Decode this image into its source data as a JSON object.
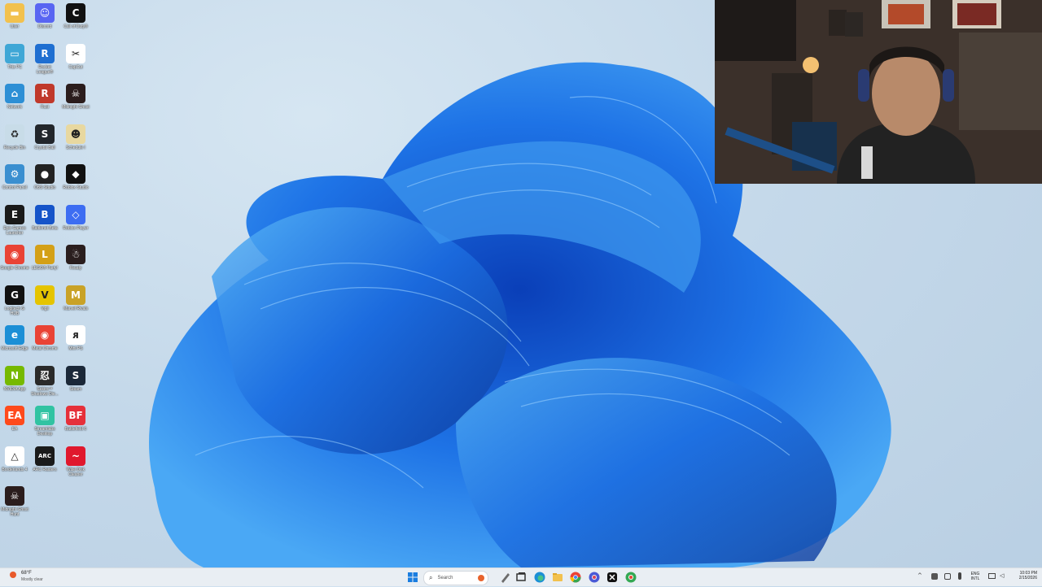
{
  "desktop": {
    "icons": [
      {
        "label": "User",
        "color": "#f2c14e",
        "glyph": "▬",
        "icon": "folder-icon"
      },
      {
        "label": "Discord",
        "color": "#5865f2",
        "glyph": "☺",
        "icon": "discord-icon"
      },
      {
        "label": "Call of Duty®",
        "color": "#111111",
        "glyph": "C",
        "icon": "call-of-duty-icon"
      },
      {
        "label": "This PC",
        "color": "#3fa7d6",
        "glyph": "▭",
        "icon": "this-pc-icon"
      },
      {
        "label": "Rocket League®",
        "color": "#1f6fd1",
        "glyph": "R",
        "icon": "rocket-league-icon"
      },
      {
        "label": "CapCut",
        "color": "#ffffff",
        "glyph": "✂",
        "icon": "capcut-icon"
      },
      {
        "label": "Network",
        "color": "#2d8fd5",
        "glyph": "⌂",
        "icon": "network-icon"
      },
      {
        "label": "Rust",
        "color": "#c0392b",
        "glyph": "R",
        "icon": "rust-icon"
      },
      {
        "label": "Midnight Ghost",
        "color": "#2b1d1d",
        "glyph": "☠",
        "icon": "midnight-ghost-icon"
      },
      {
        "label": "Recycle Bin",
        "color": "#c8dce8",
        "glyph": "♻",
        "icon": "recycle-bin-icon"
      },
      {
        "label": "Crystal Ball",
        "color": "#22262b",
        "glyph": "S",
        "icon": "crystal-ball-icon"
      },
      {
        "label": "Schedule I",
        "color": "#e8d8a0",
        "glyph": "☻",
        "icon": "schedule-icon"
      },
      {
        "label": "Control Panel",
        "color": "#3a8fd0",
        "glyph": "⚙",
        "icon": "control-panel-icon"
      },
      {
        "label": "OBS Studio",
        "color": "#222222",
        "glyph": "●",
        "icon": "obs-studio-icon"
      },
      {
        "label": "Roblox Studio",
        "color": "#111111",
        "glyph": "◆",
        "icon": "roblox-studio-icon"
      },
      {
        "label": "Epic Games Launcher",
        "color": "#1a1a1a",
        "glyph": "E",
        "icon": "epic-games-icon"
      },
      {
        "label": "Battlenet Beta",
        "color": "#1554c9",
        "glyph": "B",
        "icon": "battlenet-icon"
      },
      {
        "label": "Roblox Player",
        "color": "#3d6df2",
        "glyph": "◇",
        "icon": "roblox-player-icon"
      },
      {
        "label": "Google Chrome",
        "color": "#e94335",
        "glyph": "◉",
        "icon": "chrome-icon"
      },
      {
        "label": "LEGO® Party!",
        "color": "#d4a017",
        "glyph": "L",
        "icon": "lego-party-icon"
      },
      {
        "label": "Ready",
        "color": "#2a1e1e",
        "glyph": "☃",
        "icon": "ready-icon"
      },
      {
        "label": "Logitech G HUB",
        "color": "#111111",
        "glyph": "G",
        "icon": "logitech-ghub-icon"
      },
      {
        "label": "Vigil",
        "color": "#e5c400",
        "glyph": "V",
        "icon": "vigil-icon"
      },
      {
        "label": "Marvel Rivals",
        "color": "#c9a227",
        "glyph": "M",
        "icon": "marvel-rivals-icon"
      },
      {
        "label": "Microsoft Edge",
        "color": "#1b8fd6",
        "glyph": "e",
        "icon": "edge-icon"
      },
      {
        "label": "Metal Chrome",
        "color": "#e94335",
        "glyph": "◉",
        "icon": "metal-chrome-icon"
      },
      {
        "label": "Mini PS",
        "color": "#ffffff",
        "glyph": "ᴙ",
        "icon": "mini-ps-icon"
      },
      {
        "label": "NVIDIA App",
        "color": "#76b900",
        "glyph": "N",
        "icon": "nvidia-app-icon"
      },
      {
        "label": "Sekiro™ Shadows Die...",
        "color": "#2a2a2a",
        "glyph": "忍",
        "icon": "sekiro-icon"
      },
      {
        "label": "Steam",
        "color": "#1b2838",
        "glyph": "S",
        "icon": "steam-icon"
      },
      {
        "label": "EA",
        "color": "#ff4a1c",
        "glyph": "EA",
        "icon": "ea-icon"
      },
      {
        "label": "Streamlabs Desktop",
        "color": "#31c3a2",
        "glyph": "▣",
        "icon": "streamlabs-icon"
      },
      {
        "label": "Battlefield 6",
        "color": "#e6303a",
        "glyph": "BF",
        "icon": "battlefield-icon"
      },
      {
        "label": "Borderlands 4",
        "color": "#ffffff",
        "glyph": "△",
        "icon": "borderlands-icon"
      },
      {
        "label": "ARC Raiders",
        "color": "#1a1a1a",
        "glyph": "ARC",
        "icon": "arc-raiders-icon"
      },
      {
        "label": "Wise Disk Cleaner",
        "color": "#e0182d",
        "glyph": "~",
        "icon": "wise-disk-icon"
      },
      {
        "label": "Midnight Ghost Hunt",
        "color": "#2b1d1d",
        "glyph": "☠",
        "icon": "midnight-ghost-hunt-icon"
      }
    ]
  },
  "taskbar": {
    "weather_temp": "68°F",
    "weather_desc": "Mostly clear",
    "search_placeholder": "Search",
    "language_line1": "ENG",
    "language_line2": "INTL",
    "clock_time": "10:03 PM",
    "clock_date": "2/15/2026",
    "pinned": [
      "start-icon",
      "search-icon",
      "pen-icon",
      "task-view-icon",
      "edge-icon",
      "file-explorer-icon",
      "chrome-icon",
      "chrome-profile-icon",
      "capcut-icon",
      "chrome-alt-icon"
    ]
  }
}
